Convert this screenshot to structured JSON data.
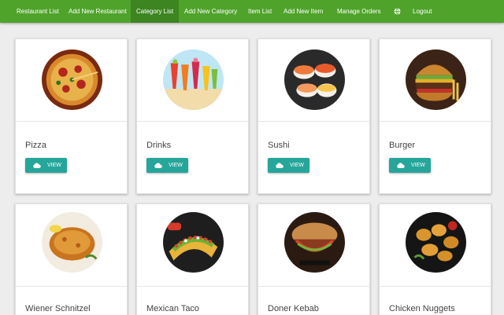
{
  "nav": {
    "items": [
      {
        "label": "Restaurant List",
        "active": false
      },
      {
        "label": "Add New Restaurant",
        "active": false
      },
      {
        "label": "Category List",
        "active": true
      },
      {
        "label": "Add New Category",
        "active": false
      },
      {
        "label": "Item List",
        "active": false
      },
      {
        "label": "Add New Item",
        "active": false
      },
      {
        "label": "Manage Orders",
        "active": false
      }
    ],
    "globe_icon": "globe-icon",
    "logout_label": "Logout"
  },
  "categories": [
    {
      "name": "Pizza",
      "button": "VIEW",
      "icon": "cloud-icon"
    },
    {
      "name": "Drinks",
      "button": "VIEW",
      "icon": "cloud-icon"
    },
    {
      "name": "Sushi",
      "button": "VIEW",
      "icon": "cloud-icon"
    },
    {
      "name": "Burger",
      "button": "VIEW",
      "icon": "cloud-icon"
    },
    {
      "name": "Wiener Schnitzel"
    },
    {
      "name": "Mexican Taco"
    },
    {
      "name": "Doner Kebab"
    },
    {
      "name": "Chicken Nuggets"
    }
  ],
  "colors": {
    "nav": "#4fa32a",
    "nav_active": "#3c8520",
    "button": "#26a69a"
  }
}
